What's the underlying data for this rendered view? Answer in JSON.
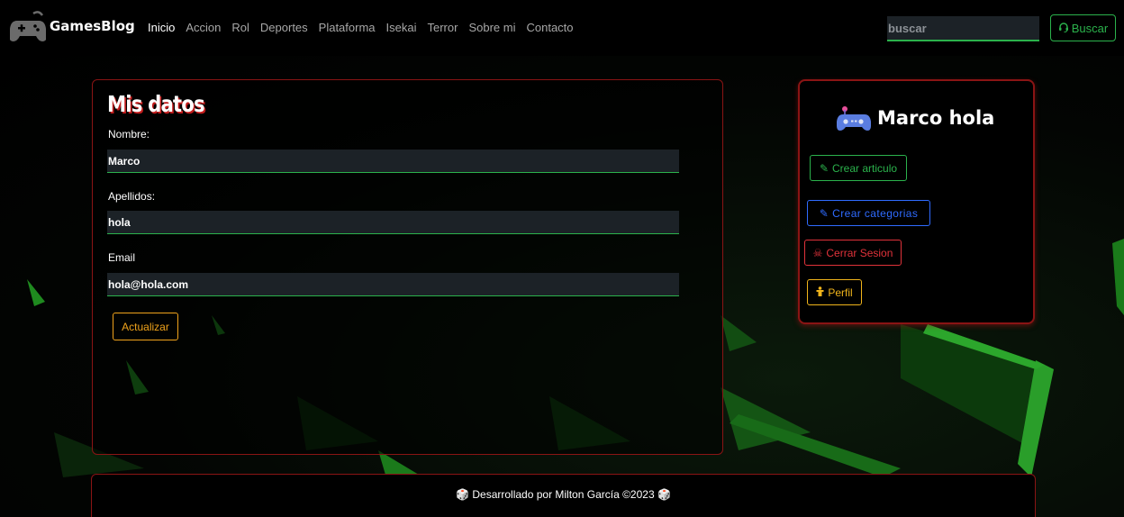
{
  "navbar": {
    "brand": "GamesBlog",
    "brand_icon": "gamepad-icon",
    "links": [
      "Inicio",
      "Accion",
      "Rol",
      "Deportes",
      "Plataforma",
      "Isekai",
      "Terror",
      "Sobre mi",
      "Contacto"
    ],
    "active_link": "Inicio",
    "search_placeholder": "buscar",
    "search_button": "Buscar"
  },
  "profile_form": {
    "title": "Mis datos",
    "fields": [
      {
        "label": "Nombre:",
        "value": "Marco"
      },
      {
        "label": "Apellidos:",
        "value": "hola"
      },
      {
        "label": "Email",
        "value": "hola@hola.com"
      }
    ],
    "submit_label": "Actualizar"
  },
  "sidebar": {
    "user_name": "Marco hola",
    "user_icon": "gamepad-icon",
    "buttons": {
      "create_article": "Crear articulo",
      "create_categories": "Crear categorias",
      "logout": "Cerrar Sesion",
      "profile": "Perfil"
    }
  },
  "footer": {
    "text": "🎲 Desarrollado por Milton García ©2023 🎲"
  },
  "colors": {
    "accent_green": "#2bb24c",
    "accent_red": "#8a1414",
    "accent_blue": "#2f6bff",
    "accent_yellow": "#f0b41b"
  }
}
